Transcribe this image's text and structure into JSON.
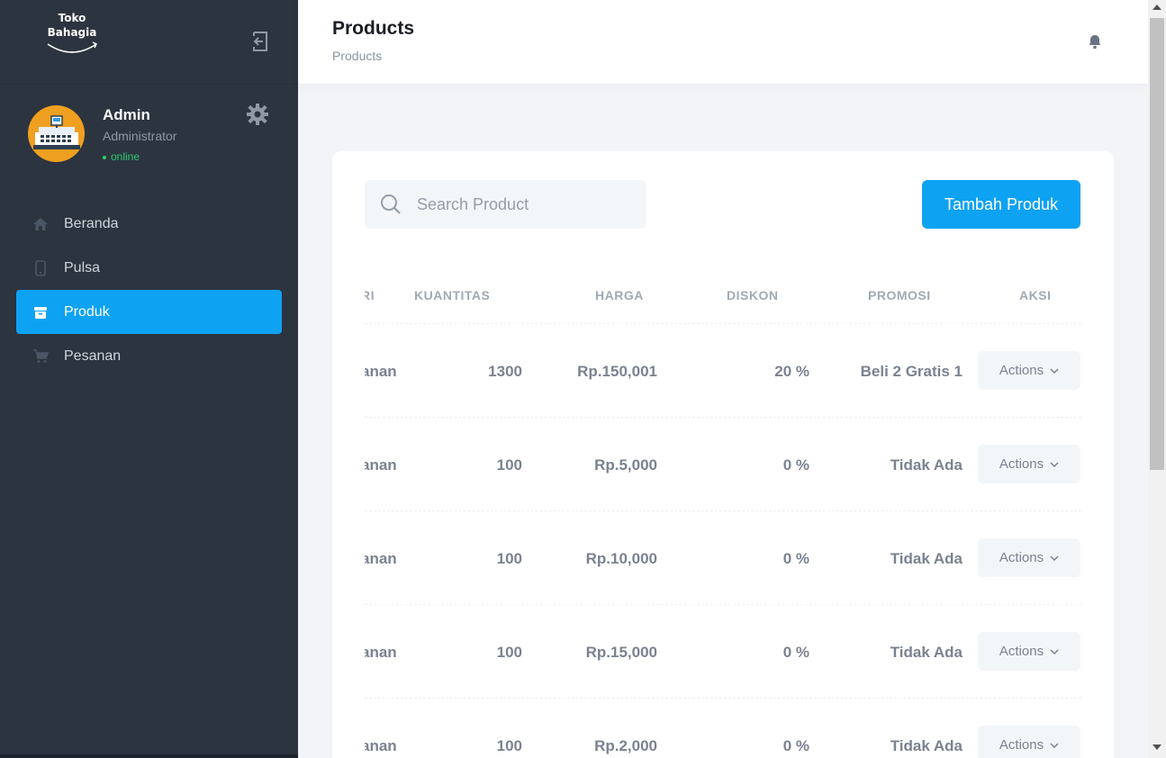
{
  "brand": {
    "line1": "Toko",
    "line2": "Bahagia"
  },
  "profile": {
    "name": "Admin",
    "role": "Administrator",
    "status": "online"
  },
  "nav": {
    "items": [
      {
        "label": "Beranda",
        "icon": "home-icon",
        "active": false
      },
      {
        "label": "Pulsa",
        "icon": "phone-icon",
        "active": false
      },
      {
        "label": "Produk",
        "icon": "box-icon",
        "active": true
      },
      {
        "label": "Pesanan",
        "icon": "cart-icon",
        "active": false
      }
    ]
  },
  "header": {
    "title": "Products",
    "breadcrumb": "Products"
  },
  "toolbar": {
    "search_placeholder": "Search Product",
    "add_label": "Tambah Produk"
  },
  "table": {
    "columns": [
      "RI",
      "KUANTITAS",
      "HARGA",
      "DISKON",
      "PROMOSI",
      "AKSI"
    ],
    "rows": [
      {
        "kategori": "anan",
        "kuantitas": "1300",
        "harga": "Rp.150,001",
        "diskon": "20 %",
        "promosi": "Beli 2 Gratis 1",
        "aksi": "Actions"
      },
      {
        "kategori": "anan",
        "kuantitas": "100",
        "harga": "Rp.5,000",
        "diskon": "0 %",
        "promosi": "Tidak Ada",
        "aksi": "Actions"
      },
      {
        "kategori": "anan",
        "kuantitas": "100",
        "harga": "Rp.10,000",
        "diskon": "0 %",
        "promosi": "Tidak Ada",
        "aksi": "Actions"
      },
      {
        "kategori": "anan",
        "kuantitas": "100",
        "harga": "Rp.15,000",
        "diskon": "0 %",
        "promosi": "Tidak Ada",
        "aksi": "Actions"
      },
      {
        "kategori": "anan",
        "kuantitas": "100",
        "harga": "Rp.2,000",
        "diskon": "0 %",
        "promosi": "Tidak Ada",
        "aksi": "Actions"
      }
    ]
  },
  "colors": {
    "sidebar": "#2c343f",
    "accent": "#0ea2f3",
    "online": "#2ecc71"
  }
}
